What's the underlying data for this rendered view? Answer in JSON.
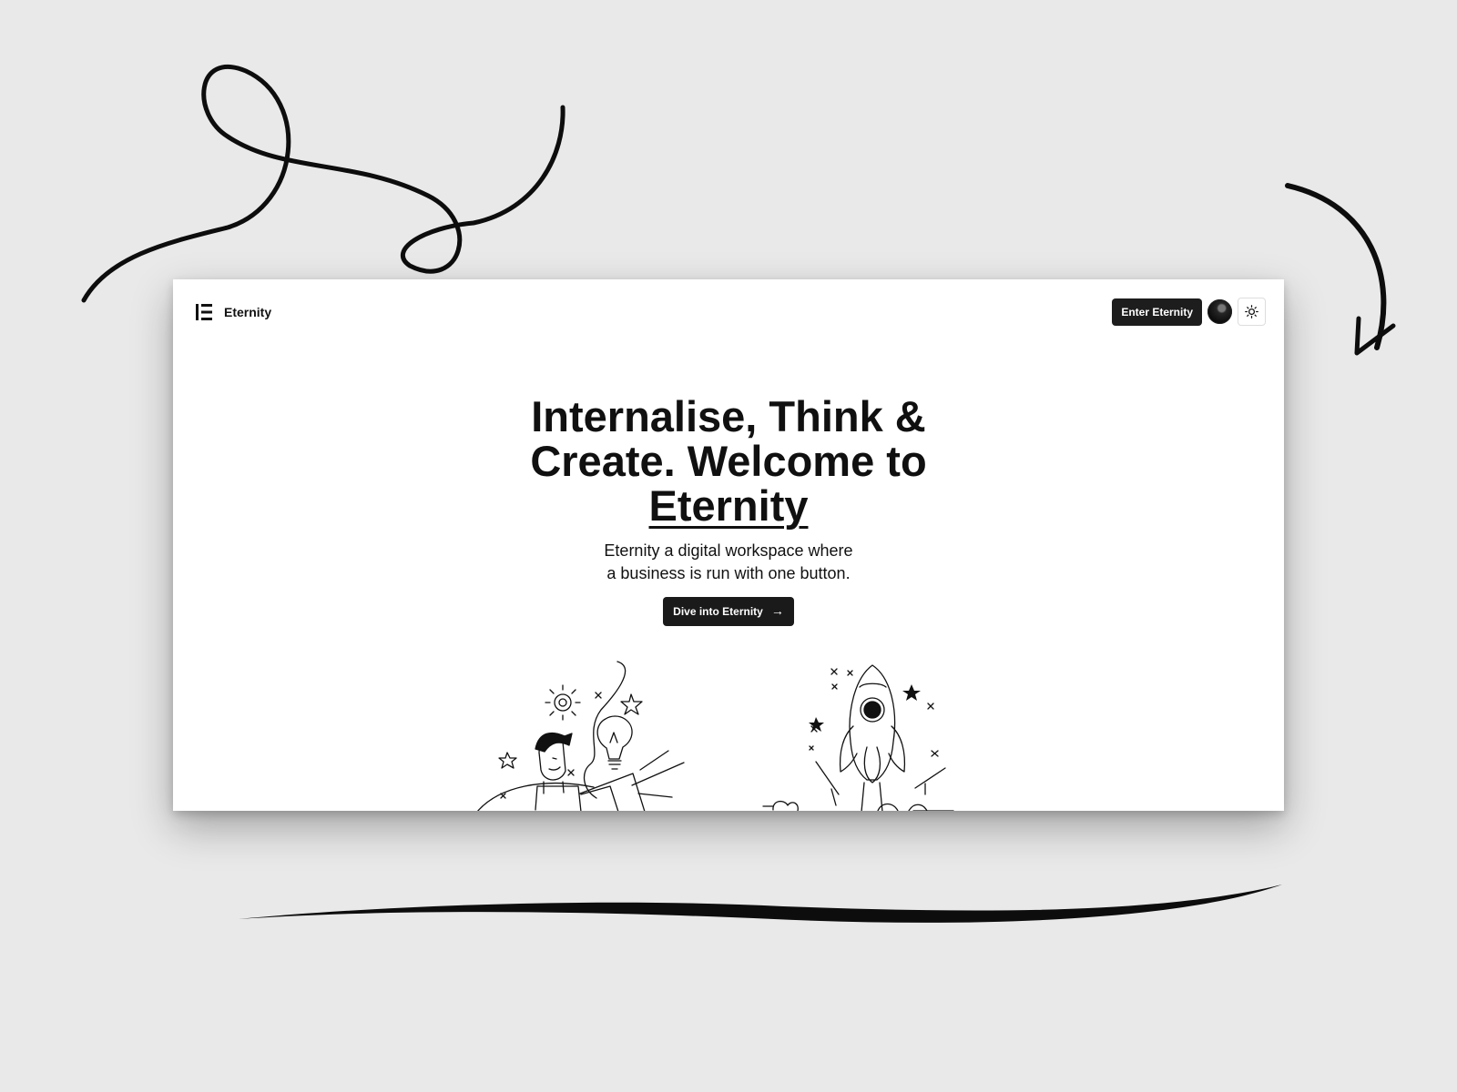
{
  "header": {
    "brand_name": "Eternity",
    "enter_button": "Enter Eternity",
    "theme_icon": "sun-icon"
  },
  "hero": {
    "title_line_1": "Internalise, Think &",
    "title_line_2": "Create. Welcome to",
    "title_highlight": "Eternity",
    "subtitle_line_1": "Eternity a digital workspace where",
    "subtitle_line_2": "a business is run with one button.",
    "cta_label": "Dive into Eternity",
    "cta_icon": "arrow-right-icon"
  },
  "illustrations": {
    "left": "thinking-person-icon",
    "right": "rocket-icon"
  },
  "colors": {
    "background": "#e9e9e9",
    "panel": "#ffffff",
    "primary": "#1a1a1a",
    "text": "#111111"
  }
}
